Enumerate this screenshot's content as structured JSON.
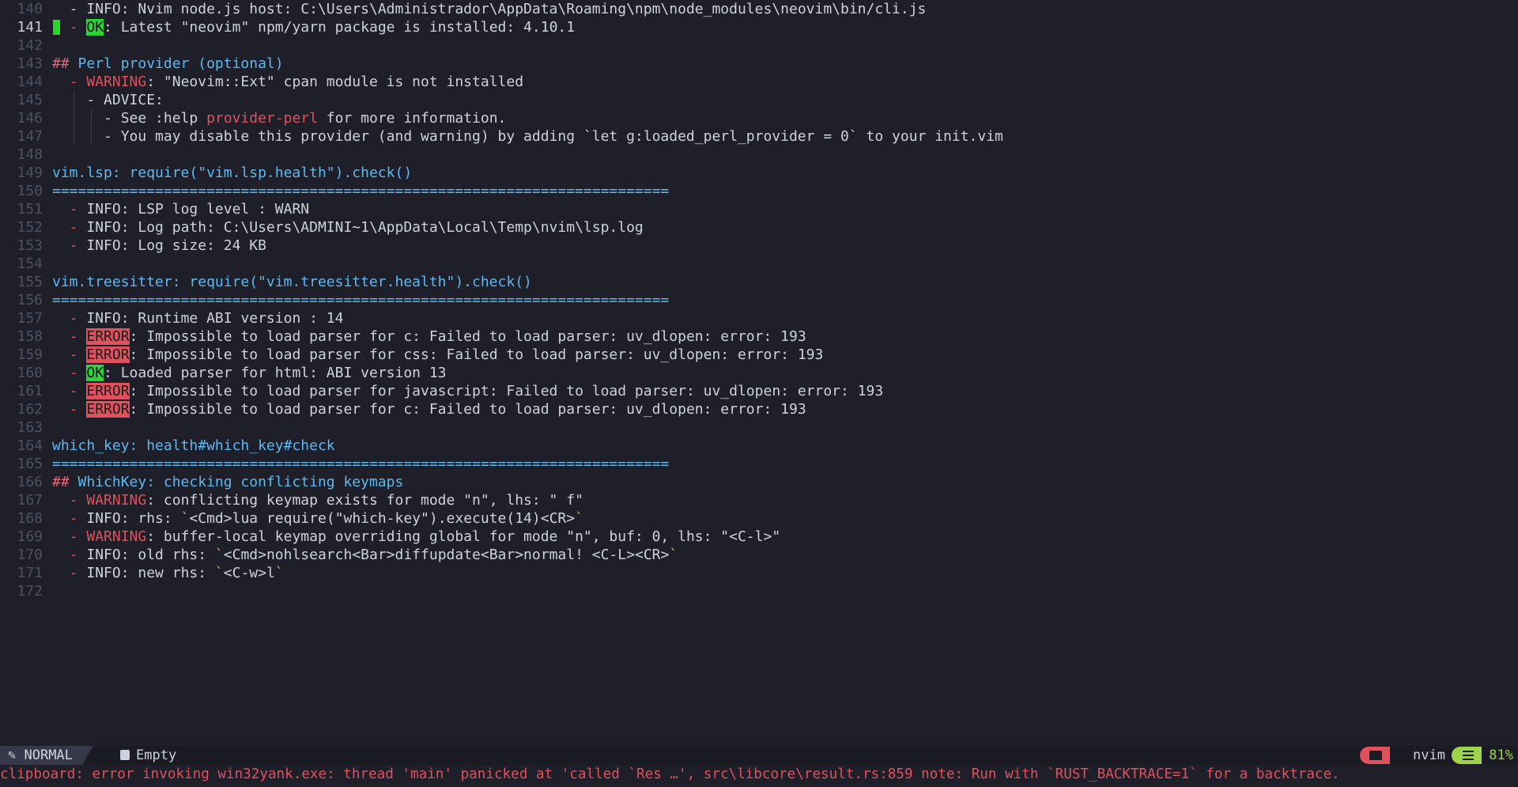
{
  "buffer": {
    "lines": [
      {
        "n": "140",
        "parts": [
          [
            "  - ",
            ""
          ],
          [
            "INFO: Nvim node.js host: C:\\Users\\Administrador\\AppData\\Roaming\\npm\\node_modules\\neovim\\bin/cli.js",
            ""
          ]
        ]
      },
      {
        "n": "141",
        "current": true,
        "parts": [
          [
            "  - ",
            "red"
          ],
          [
            "OK",
            "ok"
          ],
          [
            ": Latest \"neovim\" npm/yarn package is installed: 4.10.1",
            ""
          ]
        ]
      },
      {
        "n": "142",
        "parts": []
      },
      {
        "n": "143",
        "parts": [
          [
            "## ",
            "pink"
          ],
          [
            "Perl provider (optional)",
            "blue"
          ]
        ]
      },
      {
        "n": "144",
        "parts": [
          [
            "  - ",
            "red"
          ],
          [
            "WARNING",
            "red"
          ],
          [
            ": \"Neovim::Ext\" cpan module is not installed",
            ""
          ]
        ]
      },
      {
        "n": "145",
        "guides": [
          1
        ],
        "parts": [
          [
            "    - ADVICE:",
            ""
          ]
        ]
      },
      {
        "n": "146",
        "guides": [
          1,
          2
        ],
        "parts": [
          [
            "      - See :help ",
            ""
          ],
          [
            "provider-perl",
            "red"
          ],
          [
            " for more information.",
            ""
          ]
        ]
      },
      {
        "n": "147",
        "guides": [
          1,
          2
        ],
        "parts": [
          [
            "      - You may disable this provider (and warning) by adding `let g:loaded_perl_provider = 0` to your init.vim",
            ""
          ]
        ]
      },
      {
        "n": "148",
        "parts": []
      },
      {
        "n": "149",
        "parts": [
          [
            "vim.lsp: require(\"vim.lsp.health\").check()",
            "blue"
          ]
        ]
      },
      {
        "n": "150",
        "parts": [
          [
            "========================================================================",
            "sep"
          ]
        ]
      },
      {
        "n": "151",
        "parts": [
          [
            "  - ",
            "red"
          ],
          [
            "INFO: LSP log level : WARN",
            ""
          ]
        ]
      },
      {
        "n": "152",
        "parts": [
          [
            "  - ",
            "red"
          ],
          [
            "INFO: Log path: C:\\Users\\ADMINI~1\\AppData\\Local\\Temp\\nvim\\lsp.log",
            ""
          ]
        ]
      },
      {
        "n": "153",
        "parts": [
          [
            "  - ",
            "red"
          ],
          [
            "INFO: Log size: 24 KB",
            ""
          ]
        ]
      },
      {
        "n": "154",
        "parts": []
      },
      {
        "n": "155",
        "parts": [
          [
            "vim.treesitter: require(\"vim.treesitter.health\").check()",
            "blue"
          ]
        ]
      },
      {
        "n": "156",
        "parts": [
          [
            "========================================================================",
            "sep"
          ]
        ]
      },
      {
        "n": "157",
        "parts": [
          [
            "  - ",
            "red"
          ],
          [
            "INFO: Runtime ABI version : 14",
            ""
          ]
        ]
      },
      {
        "n": "158",
        "parts": [
          [
            "  - ",
            "red"
          ],
          [
            "ERROR",
            "err"
          ],
          [
            ": Impossible to load parser for c: Failed to load parser: uv_dlopen: error: 193",
            ""
          ]
        ]
      },
      {
        "n": "159",
        "parts": [
          [
            "  - ",
            "red"
          ],
          [
            "ERROR",
            "err"
          ],
          [
            ": Impossible to load parser for css: Failed to load parser: uv_dlopen: error: 193",
            ""
          ]
        ]
      },
      {
        "n": "160",
        "parts": [
          [
            "  - ",
            "red"
          ],
          [
            "OK",
            "ok"
          ],
          [
            ": Loaded parser for html: ABI version 13",
            ""
          ]
        ]
      },
      {
        "n": "161",
        "parts": [
          [
            "  - ",
            "red"
          ],
          [
            "ERROR",
            "err"
          ],
          [
            ": Impossible to load parser for javascript: Failed to load parser: uv_dlopen: error: 193",
            ""
          ]
        ]
      },
      {
        "n": "162",
        "parts": [
          [
            "  - ",
            "red"
          ],
          [
            "ERROR",
            "err"
          ],
          [
            ": Impossible to load parser for c: Failed to load parser: uv_dlopen: error: 193",
            ""
          ]
        ]
      },
      {
        "n": "163",
        "parts": []
      },
      {
        "n": "164",
        "parts": [
          [
            "which_key: health#which_key#check",
            "blue"
          ]
        ]
      },
      {
        "n": "165",
        "parts": [
          [
            "========================================================================",
            "sep"
          ]
        ]
      },
      {
        "n": "166",
        "parts": [
          [
            "## ",
            "pink"
          ],
          [
            "WhichKey: checking conflicting keymaps",
            "blue"
          ]
        ]
      },
      {
        "n": "167",
        "parts": [
          [
            "  - ",
            "red"
          ],
          [
            "WARNING",
            "red"
          ],
          [
            ": conflicting keymap exists for mode \"n\", lhs: \" f\"",
            ""
          ]
        ]
      },
      {
        "n": "168",
        "parts": [
          [
            "  - ",
            "red"
          ],
          [
            "INFO: rhs: ",
            ""
          ],
          [
            "`",
            "tick"
          ],
          [
            "<Cmd>lua require(\"which-key\").execute(14)<CR>",
            ""
          ],
          [
            "`",
            "tick"
          ]
        ]
      },
      {
        "n": "169",
        "parts": [
          [
            "  - ",
            "red"
          ],
          [
            "WARNING",
            "red"
          ],
          [
            ": buffer-local keymap overriding global for mode \"n\", buf: 0, lhs: \"<C-l>\"",
            ""
          ]
        ]
      },
      {
        "n": "170",
        "parts": [
          [
            "  - ",
            "red"
          ],
          [
            "INFO: old rhs: ",
            ""
          ],
          [
            "`",
            "tick"
          ],
          [
            "<Cmd>nohlsearch<Bar>diffupdate<Bar>normal! <C-L><CR>",
            ""
          ],
          [
            "`",
            "tick"
          ]
        ]
      },
      {
        "n": "171",
        "parts": [
          [
            "  - ",
            "red"
          ],
          [
            "INFO: new rhs: ",
            ""
          ],
          [
            "`",
            "tick"
          ],
          [
            "<C-w>l",
            ""
          ],
          [
            "`",
            "tick"
          ]
        ]
      },
      {
        "n": "172",
        "parts": []
      }
    ]
  },
  "statusline": {
    "mode": "NORMAL",
    "file": "Empty",
    "cwd": "nvim",
    "progress": "81%",
    "icons": {
      "mode": "pencil-icon",
      "file": "file-icon",
      "cwd": "folder-icon",
      "progress": "progress-icon"
    },
    "colors": {
      "mode_bg": "#37394a",
      "folder_accent": "#e0515e",
      "progress_accent": "#9fd34a"
    }
  },
  "cmdline": {
    "message": "clipboard: error invoking win32yank.exe: thread 'main' panicked at 'called `Res …', src\\libcore\\result.rs:859 note: Run with `RUST_BACKTRACE=1` for a backtrace."
  }
}
